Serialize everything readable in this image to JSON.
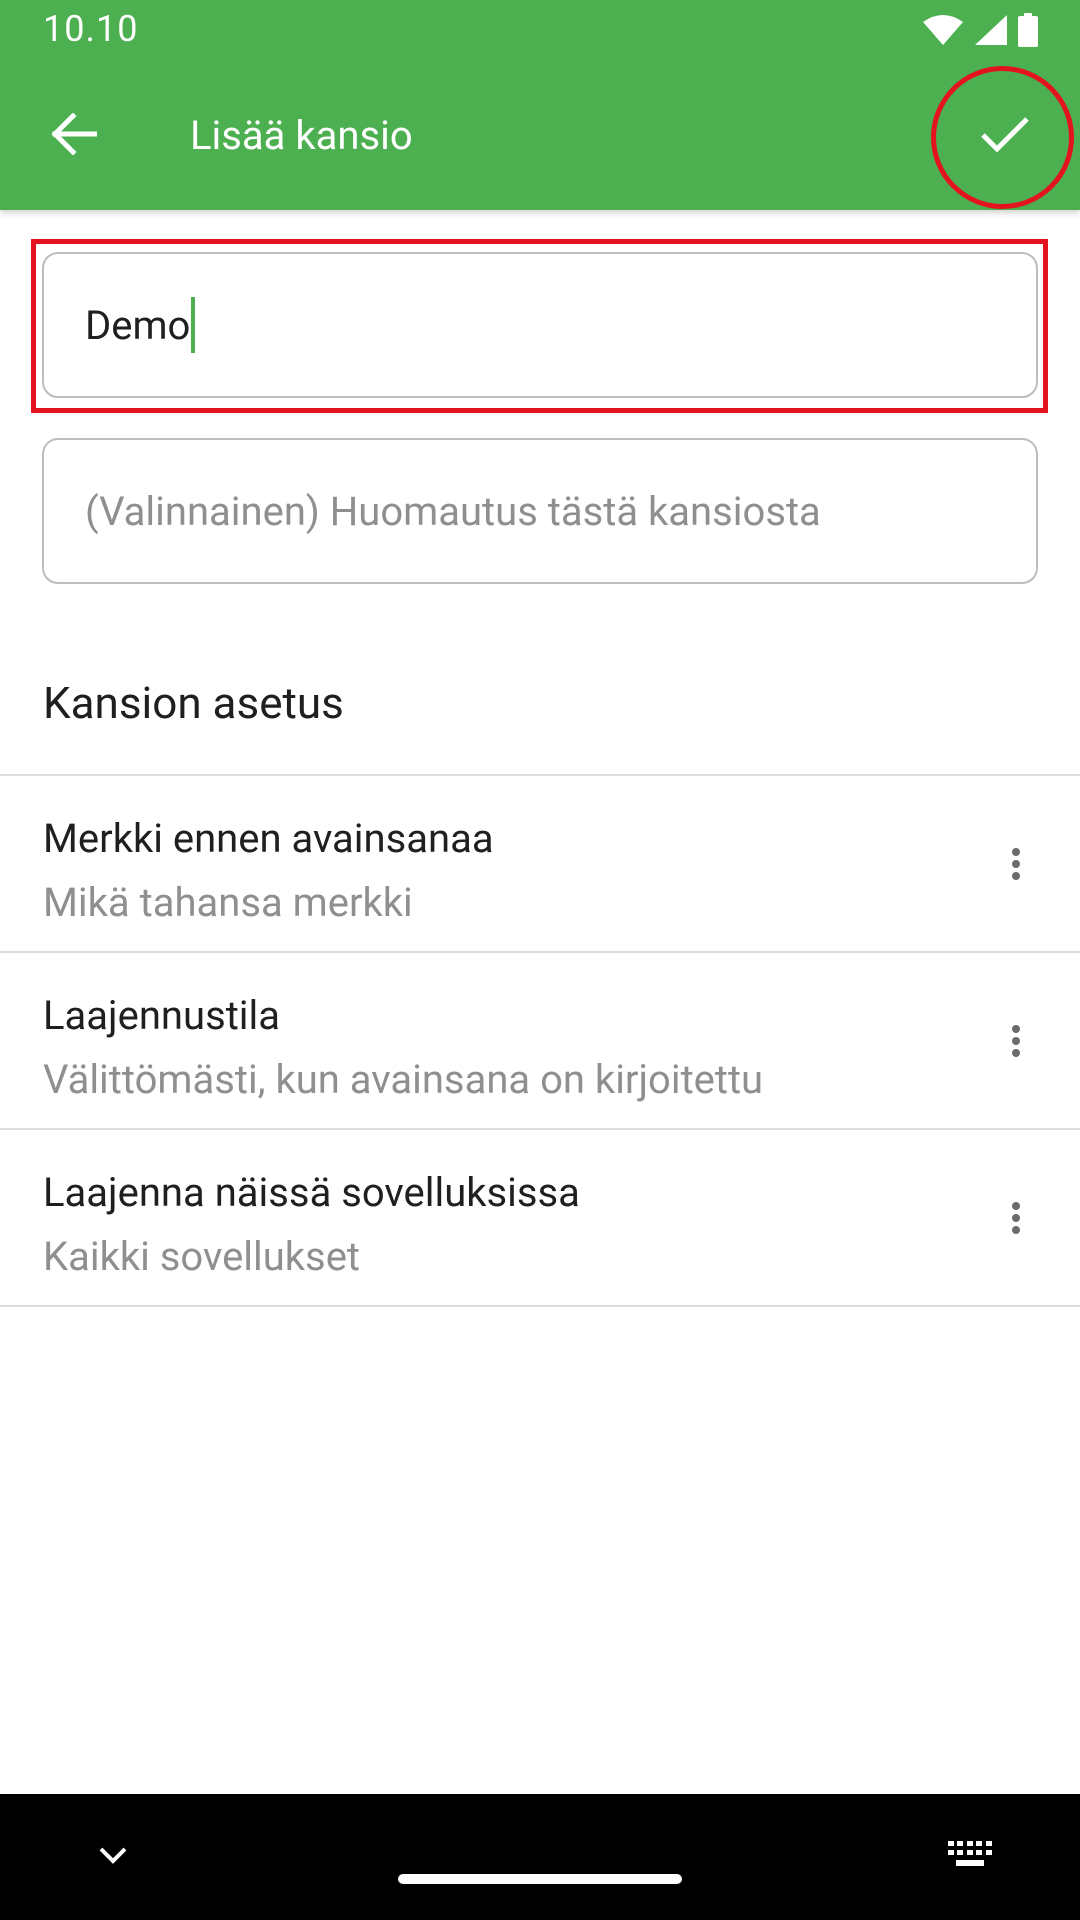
{
  "status_bar": {
    "time": "10.10",
    "icons": [
      "wifi-icon",
      "cell-signal-icon",
      "battery-icon"
    ]
  },
  "app_bar": {
    "title": "Lisää kansio",
    "back_icon": "arrow-back-icon",
    "confirm_icon": "check-icon"
  },
  "form": {
    "folder_name": {
      "value": "Demo"
    },
    "folder_note": {
      "placeholder": "(Valinnainen) Huomautus tästä kansiosta"
    }
  },
  "settings": {
    "section_title": "Kansion asetus",
    "items": [
      {
        "title": "Merkki ennen avainsanaa",
        "subtitle": "Mikä tahansa merkki"
      },
      {
        "title": "Laajennustila",
        "subtitle": "Välittömästi, kun avainsana on kirjoitettu"
      },
      {
        "title": "Laajenna näissä sovelluksissa",
        "subtitle": "Kaikki sovellukset"
      }
    ]
  },
  "navigation_bar": {
    "icons": [
      "chevron-down-icon",
      "home-handle",
      "keyboard-icon"
    ]
  },
  "colors": {
    "app_bar": "#4caf50",
    "highlight": "#e3131f",
    "caret": "#4caf50",
    "secondary_text": "#8f8f8f"
  }
}
